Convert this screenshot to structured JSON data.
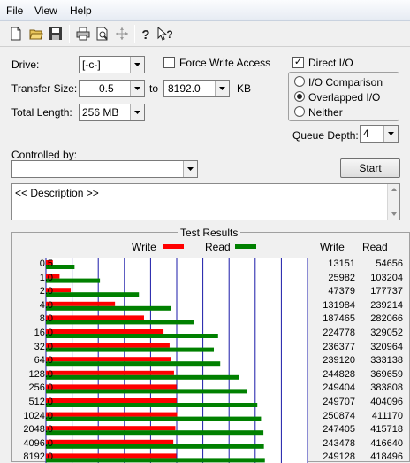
{
  "menu": {
    "file": "File",
    "view": "View",
    "help": "Help"
  },
  "toolbar": {
    "icons": [
      "new-file-icon",
      "open-folder-icon",
      "save-icon",
      "print-icon",
      "print-preview-icon",
      "move-icon",
      "help-icon",
      "context-help-icon"
    ]
  },
  "drive": {
    "label": "Drive:",
    "value": "[-c-]"
  },
  "transfer_size": {
    "label": "Transfer Size:",
    "from": "0.5",
    "to_label": "to",
    "to": "8192.0",
    "unit": "KB"
  },
  "total_length": {
    "label": "Total Length:",
    "value": "256 MB"
  },
  "force_write": {
    "label": "Force Write Access",
    "checked": false
  },
  "direct_io": {
    "label": "Direct I/O",
    "checked": true
  },
  "io_modes": [
    {
      "label": "I/O Comparison",
      "selected": false
    },
    {
      "label": "Overlapped I/O",
      "selected": true
    },
    {
      "label": "Neither",
      "selected": false
    }
  ],
  "queue_depth": {
    "label": "Queue Depth:",
    "value": "4"
  },
  "controlled_by": {
    "label": "Controlled by:",
    "value": ""
  },
  "start_button": "Start",
  "description": "<< Description >>",
  "results": {
    "title": "Test Results",
    "write_label": "Write",
    "read_label": "Read",
    "write_col": "Write",
    "read_col": "Read"
  },
  "colors": {
    "write": "#ff0000",
    "read": "#008000",
    "grid": "#1a1aa8"
  },
  "chart_data": {
    "type": "bar",
    "categories": [
      "0.5",
      "1.0",
      "2.0",
      "4.0",
      "8.0",
      "16.0",
      "32.0",
      "64.0",
      "128.0",
      "256.0",
      "512.0",
      "1024.0",
      "2048.0",
      "4096.0",
      "8192.0"
    ],
    "series": [
      {
        "name": "Write",
        "values": [
          13151,
          25982,
          47379,
          131984,
          187465,
          224778,
          236377,
          239120,
          244828,
          249404,
          249707,
          250874,
          247405,
          243478,
          249128
        ]
      },
      {
        "name": "Read",
        "values": [
          54656,
          103204,
          177737,
          239214,
          282066,
          329052,
          320964,
          333138,
          369659,
          383808,
          404096,
          411170,
          415718,
          416640,
          418496
        ]
      }
    ],
    "xlim": [
      0,
      500
    ],
    "xticks": [
      "0",
      "50",
      "100",
      "150",
      "200",
      "250",
      "300",
      "350",
      "400",
      "450",
      "500"
    ]
  }
}
